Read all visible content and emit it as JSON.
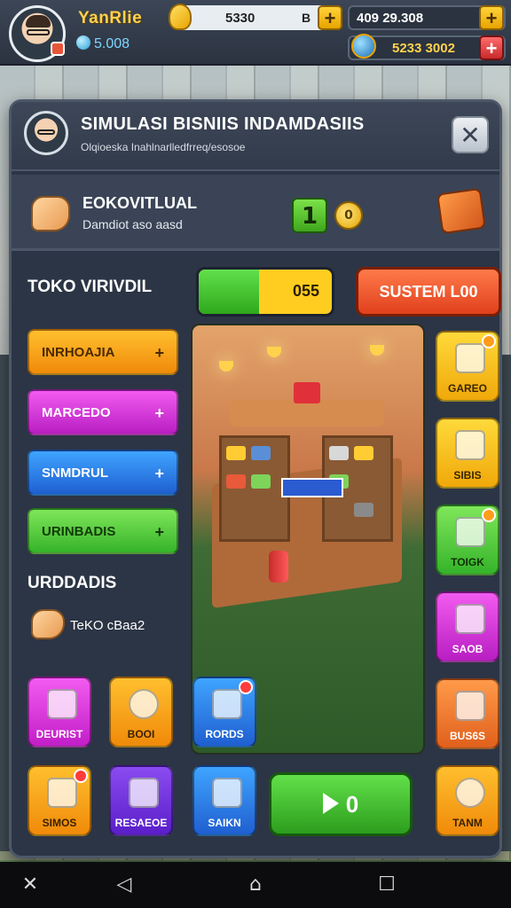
{
  "player": {
    "name": "YanRlie",
    "gems": "5.008"
  },
  "resources": {
    "coins": {
      "value": "5330",
      "symbol": "B"
    },
    "cash": {
      "value": "409 29.308"
    },
    "energy": {
      "value": "5233 3002"
    }
  },
  "panel": {
    "title": "SIMULASI BISNIIS INDAMDASIIS",
    "subtitle": "Olqioeska Inahlnarlledfrreq/esosoe",
    "info": {
      "title": "EOKOVITLUAL",
      "subtitle": "Damdiot aso aasd",
      "level": "1",
      "coin_label": "0"
    },
    "store_label": "TOKO VIRIVDIL",
    "progress": {
      "value": "055",
      "fill_fraction": 0.45
    },
    "system_button": "SUSTEM L00",
    "menu": [
      {
        "label": "INRHOAJIA",
        "plus": "+"
      },
      {
        "label": "MARCEDO",
        "plus": "+"
      },
      {
        "label": "SNMDRUL",
        "plus": "+"
      },
      {
        "label": "URINBADIS",
        "plus": "+"
      }
    ],
    "section2_label": "URDDADIS",
    "task_label": "TeKO cBaa2",
    "right_tiles": [
      "GAREO",
      "SIBIS",
      "TOIGK",
      "SAOB",
      "BUS6S"
    ],
    "bottom_row1": [
      "DEURIST",
      "BOOI",
      "RORDS"
    ],
    "bottom_row2": [
      "SIMOS",
      "RESAEOE",
      "SAIKN",
      "TANM"
    ],
    "play_button": "0",
    "close_symbol": "✕"
  },
  "nav": {
    "back": "◁",
    "home": "⌂",
    "recent": "☐",
    "close": "✕"
  }
}
